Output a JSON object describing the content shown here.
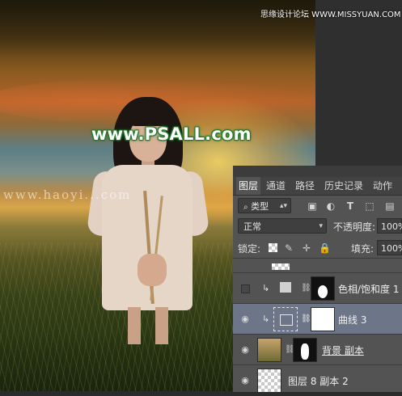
{
  "watermarks": {
    "site_top": "思缘设计论坛 WWW.MISSYUAN.COM",
    "psall": "www.PSALL.com",
    "haoyi": "www.haoyi...com"
  },
  "layers_panel": {
    "tabs": [
      {
        "label": "图层",
        "active": true
      },
      {
        "label": "通道",
        "active": false
      },
      {
        "label": "路径",
        "active": false
      },
      {
        "label": "历史记录",
        "active": false
      },
      {
        "label": "动作",
        "active": false
      }
    ],
    "filter": {
      "label": "类型",
      "icons": [
        "image-filter-icon",
        "adjustment-filter-icon",
        "type-filter-icon",
        "shape-filter-icon",
        "smart-object-filter-icon"
      ]
    },
    "blend_mode": "正常",
    "opacity_label": "不透明度:",
    "opacity_value": "100%",
    "lock_label": "锁定:",
    "fill_label": "填充:",
    "fill_value": "100%",
    "layers": [
      {
        "name": "色相/饱和度 1",
        "visible": false,
        "clipped": true,
        "selected": false
      },
      {
        "name": "曲线 3",
        "visible": true,
        "clipped": true,
        "selected": true
      },
      {
        "name": "背景 副本",
        "visible": true,
        "clipped": false,
        "selected": false
      },
      {
        "name": "图层 8 副本 2",
        "visible": true,
        "clipped": false,
        "selected": false
      }
    ]
  }
}
